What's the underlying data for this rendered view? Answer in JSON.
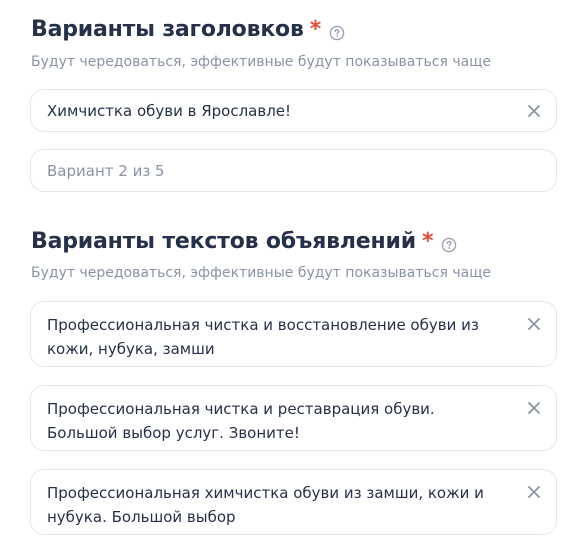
{
  "headlines": {
    "title": "Варианты заголовков",
    "required_mark": "*",
    "subtitle": "Будут чередоваться, эффективные будут показываться чаще",
    "inputs": [
      {
        "value": "Химчистка обуви в Ярославле!"
      },
      {
        "value": "",
        "placeholder": "Вариант 2 из 5"
      }
    ]
  },
  "texts": {
    "title": "Варианты текстов объявлений",
    "required_mark": "*",
    "subtitle": "Будут чередоваться, эффективные будут показываться чаще",
    "inputs": [
      {
        "value": "Профессиональная чистка и восстановление обуви из кожи, нубука, замши"
      },
      {
        "value": "Профессиональная чистка и реставрация обуви. Большой выбор услуг. Звоните!"
      },
      {
        "value": "Профессиональная химчистка обуви из замши, кожи и нубука. Большой выбор"
      }
    ]
  },
  "icons": {
    "help": "help-circle-icon",
    "clear": "close-icon"
  },
  "colors": {
    "required": "#e34b3a",
    "title": "#27304a",
    "subtitle": "#8a93a6",
    "border": "#e2e5ea"
  }
}
